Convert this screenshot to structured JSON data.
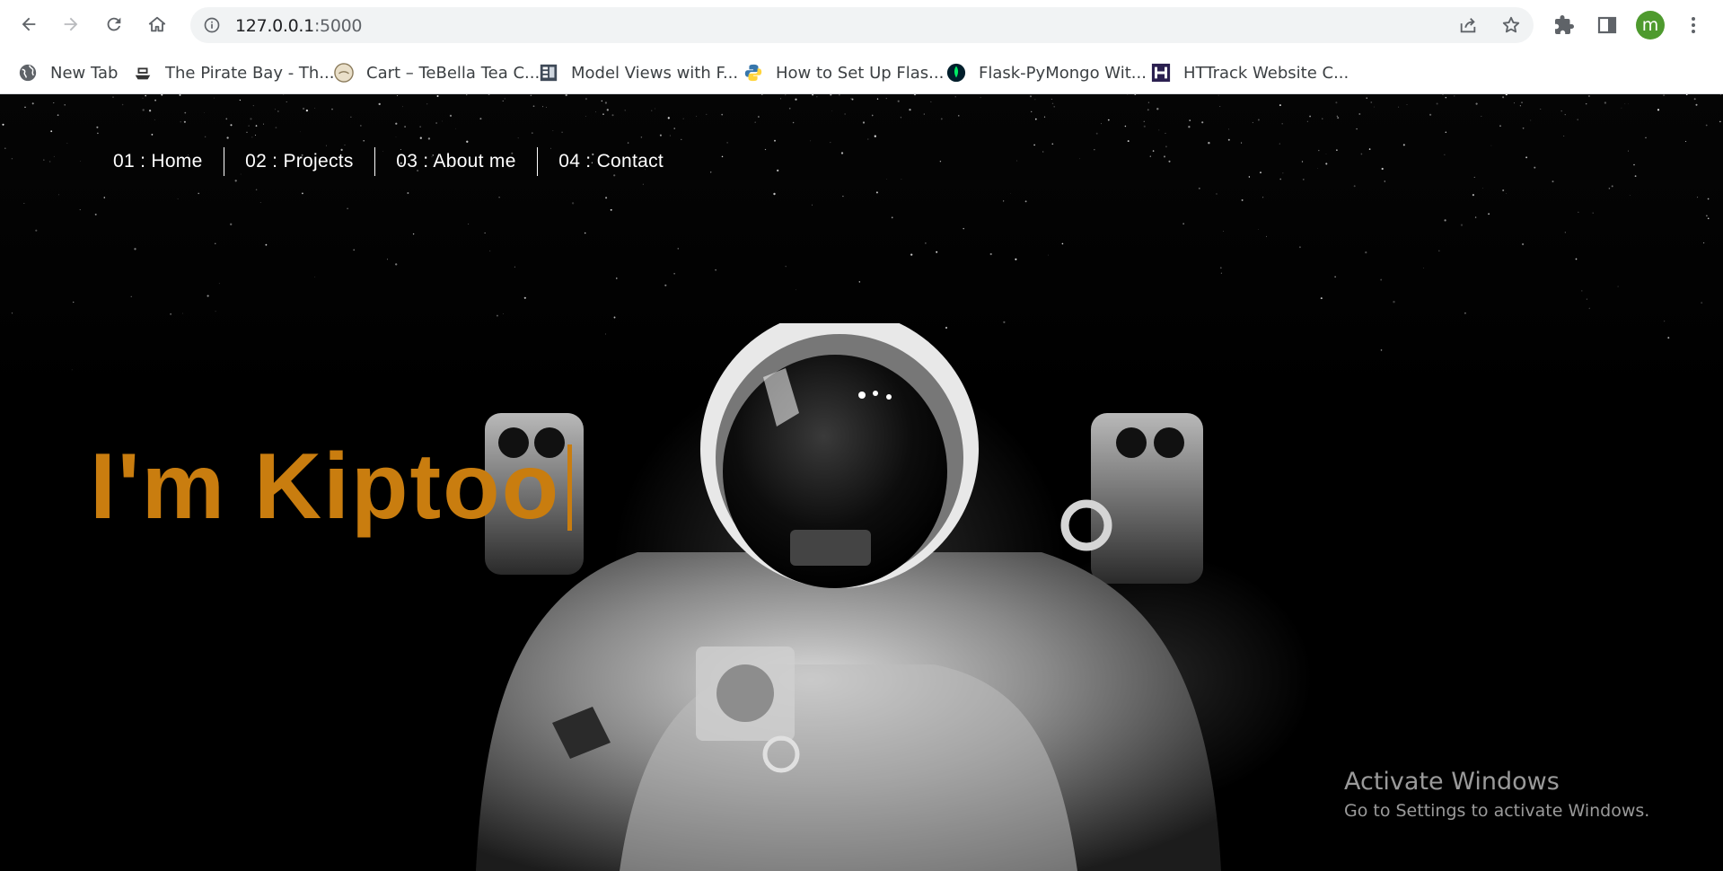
{
  "browser": {
    "url_host": "127.0.0.1",
    "url_port": ":5000",
    "profile_initial": "m",
    "bookmarks": [
      {
        "label": "New Tab",
        "icon": "globe-icon"
      },
      {
        "label": "The Pirate Bay - Th...",
        "icon": "pirate-ship-icon"
      },
      {
        "label": "Cart – TeBella Tea C...",
        "icon": "tebella-logo-icon"
      },
      {
        "label": "Model Views with F...",
        "icon": "document-grid-icon"
      },
      {
        "label": "How to Set Up Flas...",
        "icon": "python-logo-icon"
      },
      {
        "label": "Flask-PyMongo Wit...",
        "icon": "mongodb-leaf-icon"
      },
      {
        "label": "HTTrack Website C...",
        "icon": "httrack-logo-icon"
      }
    ]
  },
  "site": {
    "nav": [
      {
        "label": "01 : Home"
      },
      {
        "label": "02 : Projects"
      },
      {
        "label": "03 : About me"
      },
      {
        "label": "04 : Contact"
      }
    ],
    "hero_text": "I'm Kiptoo",
    "hero_color": "#c97d0f"
  },
  "os_overlay": {
    "title": "Activate Windows",
    "subtitle": "Go to Settings to activate Windows."
  }
}
